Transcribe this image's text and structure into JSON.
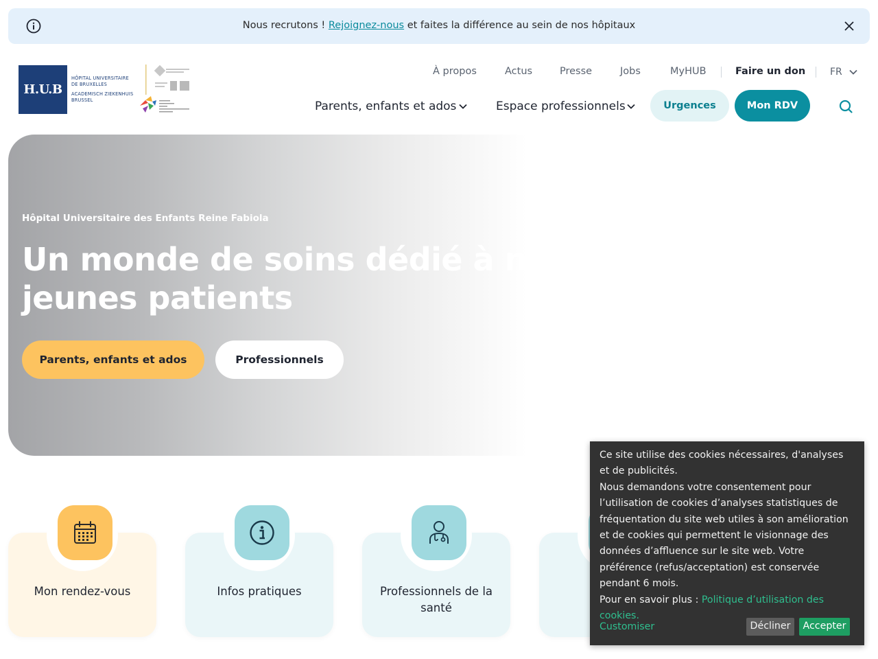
{
  "banner": {
    "prefix": "Nous recrutons ! ",
    "link": "Rejoignez-nous",
    "suffix": " et faites la différence au sein de nos hôpitaux",
    "info_icon": "info-circle-icon",
    "close_icon": "close-icon"
  },
  "logo": {
    "mark": "H.U.B",
    "lines": [
      "HÔPITAL UNIVERSITAIRE",
      "DE BRUXELLES",
      "ACADEMISCH ZIEKENHUIS",
      "BRUSSEL"
    ]
  },
  "topnav": {
    "items": [
      "À propos",
      "Actus",
      "Presse",
      "Jobs",
      "MyHUB"
    ],
    "donate": "Faire un don",
    "lang": "FR"
  },
  "mainnav": {
    "parents": "Parents, enfants et ados",
    "pros": "Espace professionnels",
    "urgences": "Urgences",
    "rdv": "Mon RDV"
  },
  "hero": {
    "eyebrow": "Hôpital Universitaire des Enfants Reine Fabiola",
    "title_line1": "Un monde de soins dédié à nos",
    "title_line2": "jeunes patients",
    "btn_parents": "Parents, enfants et ados",
    "btn_pros": "Professionnels"
  },
  "cards": [
    {
      "label": "Mon rendez-vous",
      "icon": "calendar-icon"
    },
    {
      "label": "Infos pratiques",
      "icon": "info-icon"
    },
    {
      "label": "Professionnels de la santé",
      "icon": "doctor-icon"
    },
    {
      "label": "",
      "icon": "hidden-icon"
    }
  ],
  "cookie": {
    "p1": "Ce site utilise des cookies nécessaires, d'analyses et de publicités.",
    "p2": "Nous demandons votre consentement pour l’utilisation de cookies d’analyses statistiques de fréquentation du site web utiles à son amélioration et de cookies qui permettent le visionnage des données d’affluence sur le site web. Votre préférence (refus/acceptation) est conservée pendant 6 mois.",
    "p3_prefix": "Pour en savoir plus : ",
    "p3_link": "Politique d’utilisation des cookies.",
    "customize": "Customiser",
    "decline": "Décliner",
    "accept": "Accepter"
  },
  "colors": {
    "brand_teal": "#0b8fa0",
    "brand_navy": "#1d3f78",
    "accent_yellow": "#fdc35f",
    "banner_bg": "#e4f0fb"
  }
}
